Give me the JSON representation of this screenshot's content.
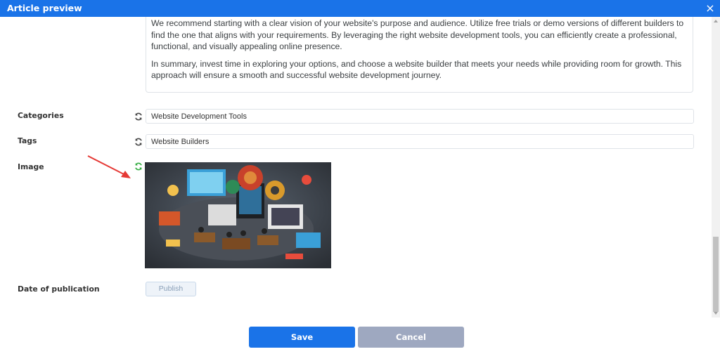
{
  "window": {
    "title": "Article preview",
    "close_label": "×"
  },
  "body_text": {
    "paragraph1": "We recommend starting with a clear vision of your website's purpose and audience. Utilize free trials or demo versions of different builders to find the one that aligns with your requirements. By leveraging the right website development tools, you can efficiently create a professional, functional, and visually appealing online presence.",
    "paragraph2": "In summary, invest time in exploring your options, and choose a website builder that meets your needs while providing room for growth. This approach will ensure a smooth and successful website development journey."
  },
  "fields": {
    "categories": {
      "label": "Categories",
      "value": "Website Development Tools"
    },
    "tags": {
      "label": "Tags",
      "value": "Website Builders"
    },
    "image": {
      "label": "Image"
    },
    "date": {
      "label": "Date of publication",
      "button": "Publish"
    }
  },
  "footer": {
    "save_label": "Save",
    "cancel_label": "Cancel"
  },
  "colors": {
    "accent": "#1a73e8",
    "cancel": "#9ea8c0",
    "refresh_active": "#2eaa3c",
    "annotation": "#e53935"
  },
  "icons": {
    "refresh": "refresh-icon",
    "close": "close-icon",
    "annotation": "red-arrow"
  }
}
